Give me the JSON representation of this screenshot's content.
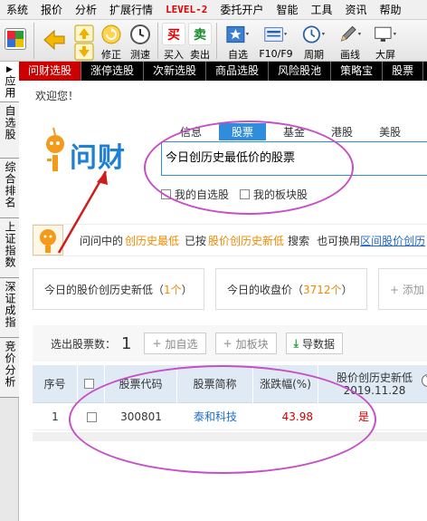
{
  "menu": [
    "系统",
    "报价",
    "分析",
    "扩展行情",
    "LEVEL-2",
    "委托开户",
    "智能",
    "工具",
    "资讯",
    "帮助"
  ],
  "toolbar": {
    "items": [
      {
        "label": "",
        "icon": "color-block-icon"
      },
      {
        "label": "",
        "icon": "back-arrow-icon"
      },
      {
        "label": "",
        "icon": "up-down-arrow-icon"
      },
      {
        "label": "修正",
        "icon": "refresh-icon"
      },
      {
        "label": "测速",
        "icon": "clock-icon"
      },
      {
        "label": "买入",
        "icon": "buy-icon",
        "glyph": "买"
      },
      {
        "label": "卖出",
        "icon": "sell-icon",
        "glyph": "卖"
      },
      {
        "label": "自选",
        "icon": "star-icon"
      },
      {
        "label": "F10/F9",
        "icon": "f10-icon"
      },
      {
        "label": "周期",
        "icon": "period-icon"
      },
      {
        "label": "画线",
        "icon": "pencil-icon"
      },
      {
        "label": "大屏",
        "icon": "big-screen-icon"
      }
    ]
  },
  "left_tabs": [
    "应用",
    "自选股",
    "综合排名",
    "上证指数",
    "深证成指",
    "竞价分析"
  ],
  "tabs": [
    "问财选股",
    "涨停选股",
    "次新选股",
    "商品选股",
    "风险股池",
    "策略宝",
    "股票"
  ],
  "welcome": "欢迎您！",
  "logo_text": "问财",
  "search": {
    "tabs": [
      "信息",
      "股票",
      "基金",
      "港股",
      "美股"
    ],
    "active_tab": "股票",
    "query": "今日创历史最低价的股票",
    "options": [
      "我的自选股",
      "我的板块股"
    ]
  },
  "assist": {
    "prefix": "问问中的",
    "term1": "创历史最低",
    "mid": "已按",
    "term2": "股价创历史新低",
    "suffix": "搜索",
    "alt_prefix": "也可换用",
    "alt_link": "区间股价创历"
  },
  "cards": [
    {
      "text": "今日的股价创历史新低（",
      "count": "1个",
      "tail": "）"
    },
    {
      "text": "今日的收盘价（",
      "count": "3712个",
      "tail": "）"
    },
    {
      "text": "+ 添加"
    }
  ],
  "results": {
    "label": "选出股票数：",
    "count": "1",
    "buttons": [
      "加自选",
      "加板块",
      "导数据"
    ]
  },
  "table": {
    "headers": [
      "序号",
      "",
      "股票代码",
      "股票简称",
      "涨跌幅(%)",
      "股价创历史新低",
      "2019.11.28",
      "?"
    ],
    "rows": [
      {
        "index": "1",
        "code": "300801",
        "name": "泰和科技",
        "change": "43.98",
        "flag": "是"
      }
    ]
  },
  "colors": {
    "accent": "#2f8ddc",
    "tab_active": "#cc0000",
    "annotation": "#c64ec6",
    "up": "#d00000"
  }
}
